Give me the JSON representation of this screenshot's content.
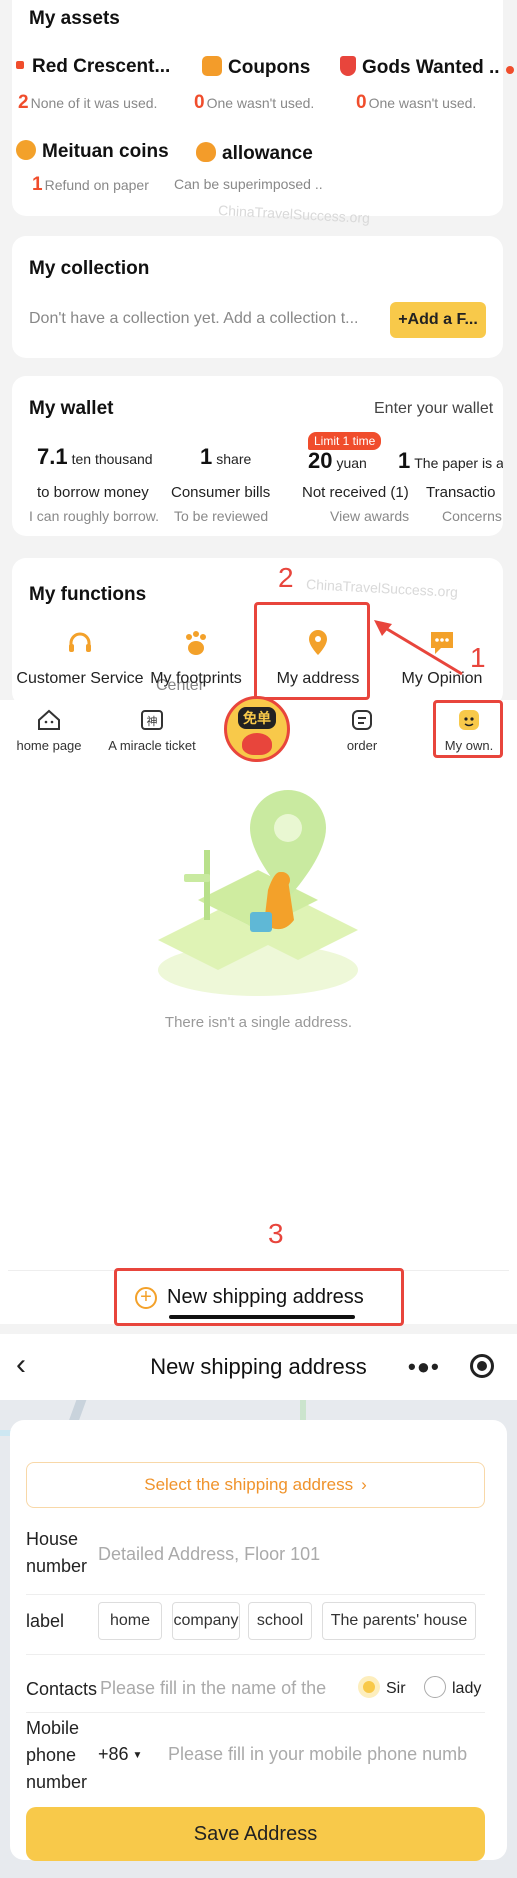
{
  "assets": {
    "title": "My assets",
    "items": [
      {
        "label": "Red Crescent...",
        "num": "2",
        "sub": "None of it was used.",
        "color": "#f04d2c"
      },
      {
        "label": "Coupons",
        "num": "0",
        "sub": "One wasn't used.",
        "color": "#f39c2a"
      },
      {
        "label": "Gods Wanted ..",
        "num": "0",
        "sub": "One wasn't used.",
        "color": "#e8453c"
      },
      {
        "label": "Meituan coins",
        "num": "1",
        "sub": "Refund on paper",
        "color": "#f3a12a"
      },
      {
        "label": "allowance",
        "num": "",
        "sub": "Can be superimposed ..",
        "color": "#f39c2a"
      }
    ]
  },
  "watermark": "ChinaTravelSuccess.org",
  "collection": {
    "title": "My collection",
    "empty_text": "Don't have a collection yet. Add a collection t...",
    "button": "+Add a F..."
  },
  "wallet": {
    "title": "My wallet",
    "enter": "Enter your wallet",
    "badge": "Limit 1 time",
    "items": [
      {
        "num": "7.1",
        "unit": "ten thousand",
        "label": "to borrow money",
        "sub": "I can roughly borrow."
      },
      {
        "num": "1",
        "unit": "share",
        "label": "Consumer bills",
        "sub": "To be reviewed"
      },
      {
        "num": "20",
        "unit": "yuan",
        "label": "Not received (1)",
        "sub": "View awards"
      },
      {
        "num": "1",
        "unit": "The paper is a",
        "label": "Transactio",
        "sub": "Concerns"
      }
    ]
  },
  "functions": {
    "title": "My functions",
    "items": [
      "Customer Service",
      "My footprints",
      "My address",
      "My Opinion"
    ],
    "overlap_label": "Center"
  },
  "tabbar": {
    "items": [
      "home page",
      "A miracle ticket",
      "",
      "order",
      "My own."
    ],
    "center_badge": "免单"
  },
  "annotations": {
    "step1": "1",
    "step2": "2",
    "step3": "3"
  },
  "empty_address": {
    "text": "There isn't a single address.",
    "new_button": "New shipping address"
  },
  "form": {
    "header_title": "New shipping address",
    "select_address": "Select the shipping address",
    "house_label": "House number",
    "house_placeholder": "Detailed Address, Floor 101",
    "label_label": "label",
    "tags": [
      "home",
      "company",
      "school",
      "The parents' house"
    ],
    "contacts_label": "Contacts",
    "contacts_placeholder": "Please fill in the name of the",
    "gender": [
      "Sir",
      "lady"
    ],
    "phone_label": "Mobile phone number",
    "country_code": "+86",
    "phone_placeholder": "Please fill in your mobile phone numb",
    "save_button": "Save Address"
  },
  "colors": {
    "accent_yellow": "#f8c94a",
    "annotation_red": "#e8453c",
    "orange": "#f39c2a"
  }
}
